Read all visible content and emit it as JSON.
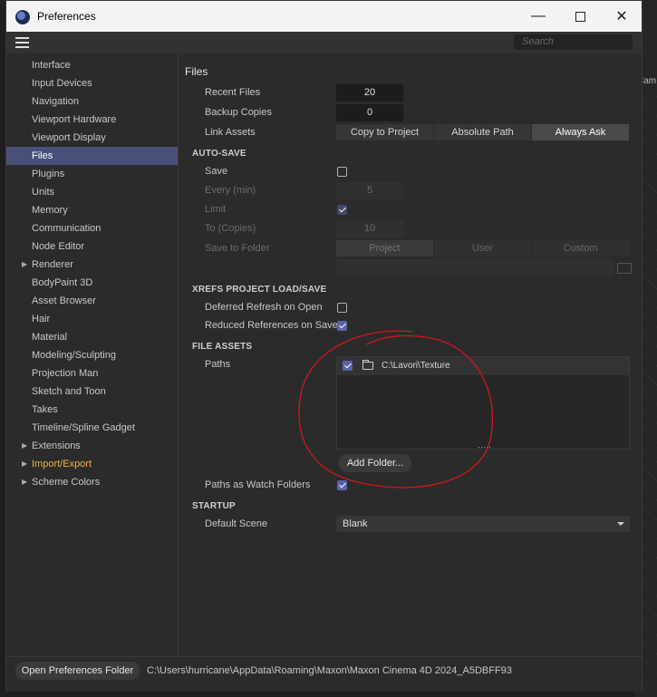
{
  "window": {
    "title": "Preferences",
    "search_placeholder": "Search"
  },
  "background": {
    "viewport_label": "Cam"
  },
  "sidebar": {
    "items": [
      {
        "label": "Interface",
        "expandable": false
      },
      {
        "label": "Input Devices",
        "expandable": false
      },
      {
        "label": "Navigation",
        "expandable": false
      },
      {
        "label": "Viewport Hardware",
        "expandable": false
      },
      {
        "label": "Viewport Display",
        "expandable": false
      },
      {
        "label": "Files",
        "expandable": false,
        "selected": true
      },
      {
        "label": "Plugins",
        "expandable": false
      },
      {
        "label": "Units",
        "expandable": false
      },
      {
        "label": "Memory",
        "expandable": false
      },
      {
        "label": "Communication",
        "expandable": false
      },
      {
        "label": "Node Editor",
        "expandable": false
      },
      {
        "label": "Renderer",
        "expandable": true
      },
      {
        "label": "BodyPaint 3D",
        "expandable": false
      },
      {
        "label": "Asset Browser",
        "expandable": false
      },
      {
        "label": "Hair",
        "expandable": false
      },
      {
        "label": "Material",
        "expandable": false
      },
      {
        "label": "Modeling/Sculpting",
        "expandable": false
      },
      {
        "label": "Projection Man",
        "expandable": false
      },
      {
        "label": "Sketch and Toon",
        "expandable": false
      },
      {
        "label": "Takes",
        "expandable": false
      },
      {
        "label": "Timeline/Spline Gadget",
        "expandable": false
      },
      {
        "label": "Extensions",
        "expandable": true
      },
      {
        "label": "Import/Export",
        "expandable": true,
        "highlight": true
      },
      {
        "label": "Scheme Colors",
        "expandable": true
      }
    ]
  },
  "files": {
    "title": "Files",
    "recent_files_label": "Recent Files",
    "recent_files_value": "20",
    "backup_copies_label": "Backup Copies",
    "backup_copies_value": "0",
    "link_assets_label": "Link Assets",
    "link_assets_options": [
      "Copy to Project",
      "Absolute Path",
      "Always Ask"
    ],
    "link_assets_selected": "Always Ask"
  },
  "autosave": {
    "title": "AUTO-SAVE",
    "save_label": "Save",
    "save_checked": false,
    "every_label": "Every (min)",
    "every_value": "5",
    "limit_label": "Limit",
    "limit_checked": true,
    "to_copies_label": "To (Copies)",
    "to_copies_value": "10",
    "save_to_folder_label": "Save to Folder",
    "save_to_folder_options": [
      "Project",
      "User",
      "Custom"
    ]
  },
  "xrefs": {
    "title": "XREFS PROJECT LOAD/SAVE",
    "deferred_label": "Deferred Refresh on Open",
    "deferred_checked": false,
    "reduced_label": "Reduced References on Save",
    "reduced_checked": true
  },
  "file_assets": {
    "title": "FILE ASSETS",
    "paths_label": "Paths",
    "paths": [
      {
        "checked": true,
        "path": "C:\\Lavori\\Texture"
      }
    ],
    "add_folder_label": "Add Folder...",
    "watch_label": "Paths as Watch Folders",
    "watch_checked": true
  },
  "startup": {
    "title": "STARTUP",
    "default_scene_label": "Default Scene",
    "default_scene_value": "Blank"
  },
  "footer": {
    "open_button": "Open Preferences Folder",
    "path": "C:\\Users\\hurricane\\AppData\\Roaming\\Maxon\\Maxon Cinema 4D 2024_A5DBFF93"
  },
  "colors": {
    "accent": "#5b63a8",
    "selection": "#4a4f7a",
    "annotation": "#d01818",
    "highlight_text": "#f0b040"
  }
}
